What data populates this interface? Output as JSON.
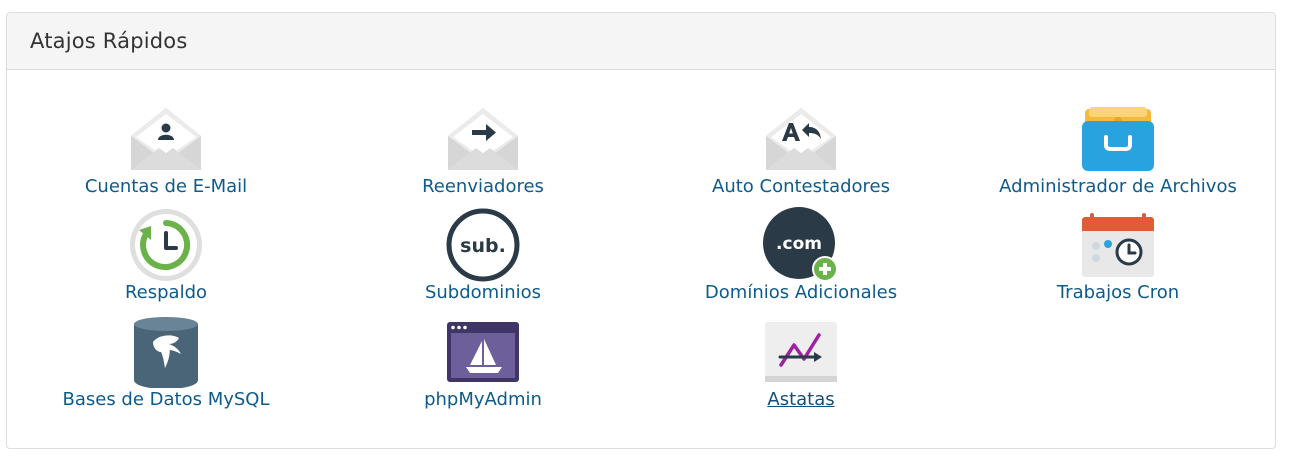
{
  "panel": {
    "title": "Atajos Rápidos"
  },
  "items": [
    {
      "label": "Cuentas de E-Mail",
      "icon": "email-accounts-icon"
    },
    {
      "label": "Reenviadores",
      "icon": "forwarders-icon"
    },
    {
      "label": "Auto Contestadores",
      "icon": "autoresponders-icon"
    },
    {
      "label": "Administrador de Archivos",
      "icon": "file-manager-icon"
    },
    {
      "label": "Respaldo",
      "icon": "backup-icon"
    },
    {
      "label": "Subdominios",
      "icon": "subdomains-icon",
      "icon_text": "sub."
    },
    {
      "label": "Domínios Adicionales",
      "icon": "addon-domains-icon",
      "icon_text": ".com"
    },
    {
      "label": "Trabajos Cron",
      "icon": "cron-jobs-icon"
    },
    {
      "label": "Bases de Datos MySQL",
      "icon": "mysql-databases-icon"
    },
    {
      "label": "phpMyAdmin",
      "icon": "phpmyadmin-icon"
    },
    {
      "label": "Astatas",
      "icon": "awstats-icon"
    }
  ],
  "colors": {
    "link": "#0d5b8c",
    "envelope": "#d9d9d9",
    "dark": "#2b3a47",
    "folder_blue": "#29a3e0",
    "folder_yellow": "#f6b93b",
    "green": "#6bb24a",
    "red": "#d9534f",
    "purple": "#5a4a7e"
  }
}
